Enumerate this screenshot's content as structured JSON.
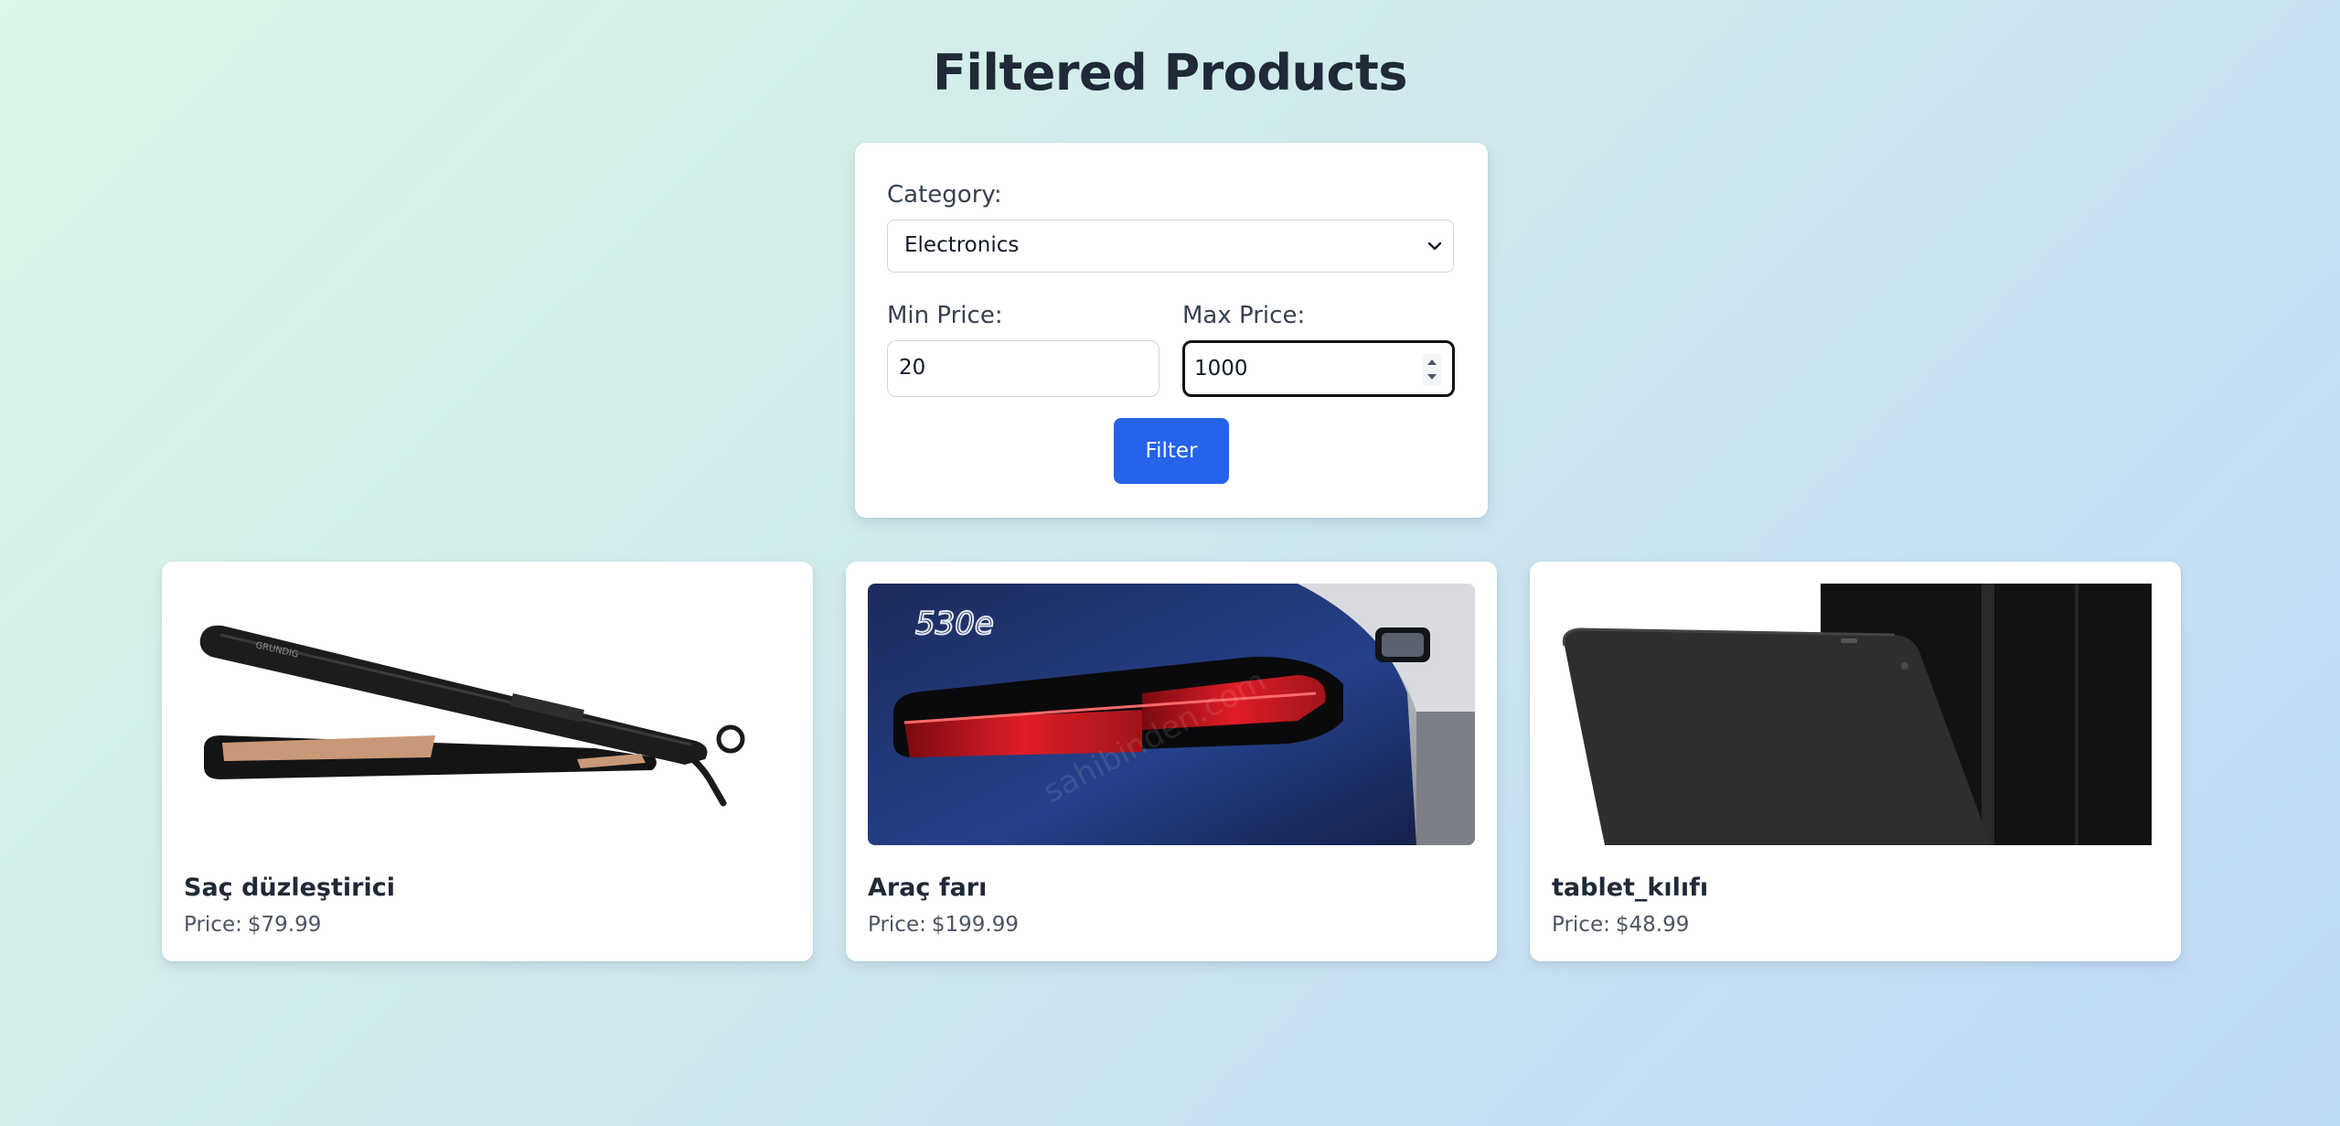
{
  "page": {
    "title": "Filtered Products"
  },
  "filters": {
    "category_label": "Category:",
    "category_value": "Electronics",
    "min_price_label": "Min Price:",
    "min_price_value": "20",
    "max_price_label": "Max Price:",
    "max_price_value": "1000",
    "filter_button_label": "Filter"
  },
  "price_prefix": "Price:",
  "products": [
    {
      "name": "Saç düzleştirici",
      "price": "$79.99",
      "image_icon": "hair-straightener-image"
    },
    {
      "name": "Araç farı",
      "price": "$199.99",
      "image_icon": "car-tail-light-image",
      "image_text": "530e"
    },
    {
      "name": "tablet_kılıfı",
      "price": "$48.99",
      "image_icon": "tablet-case-image"
    }
  ],
  "colors": {
    "accent": "#2563eb",
    "title": "#1f2937",
    "price": "#4b5563"
  }
}
